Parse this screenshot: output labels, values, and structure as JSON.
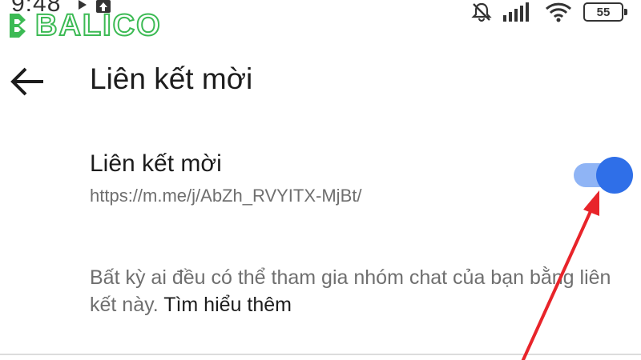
{
  "status_bar": {
    "time": "9:48",
    "battery": "55",
    "icons": [
      "play-icon",
      "upload-icon",
      "bell-off-icon",
      "signal-icon",
      "wifi-icon",
      "battery-icon"
    ]
  },
  "watermark": {
    "text": "BALICO",
    "color": "#3cba54"
  },
  "header": {
    "title": "Liên kết mời",
    "back_icon": "arrow-left-icon"
  },
  "invite_link_setting": {
    "title": "Liên kết mời",
    "link": "https://m.me/j/AbZh_RVYITX-MjBt/",
    "toggle_on": true,
    "toggle_color": "#2f6fe8",
    "toggle_track_color": "#8fb4f5"
  },
  "description": {
    "text": "Bất kỳ ai đều có thể tham gia nhóm chat của bạn bằng liên kết này. ",
    "learn_more": "Tìm hiểu thêm"
  },
  "annotation": {
    "color": "#e8242a",
    "icon": "red-arrow-pointer"
  }
}
